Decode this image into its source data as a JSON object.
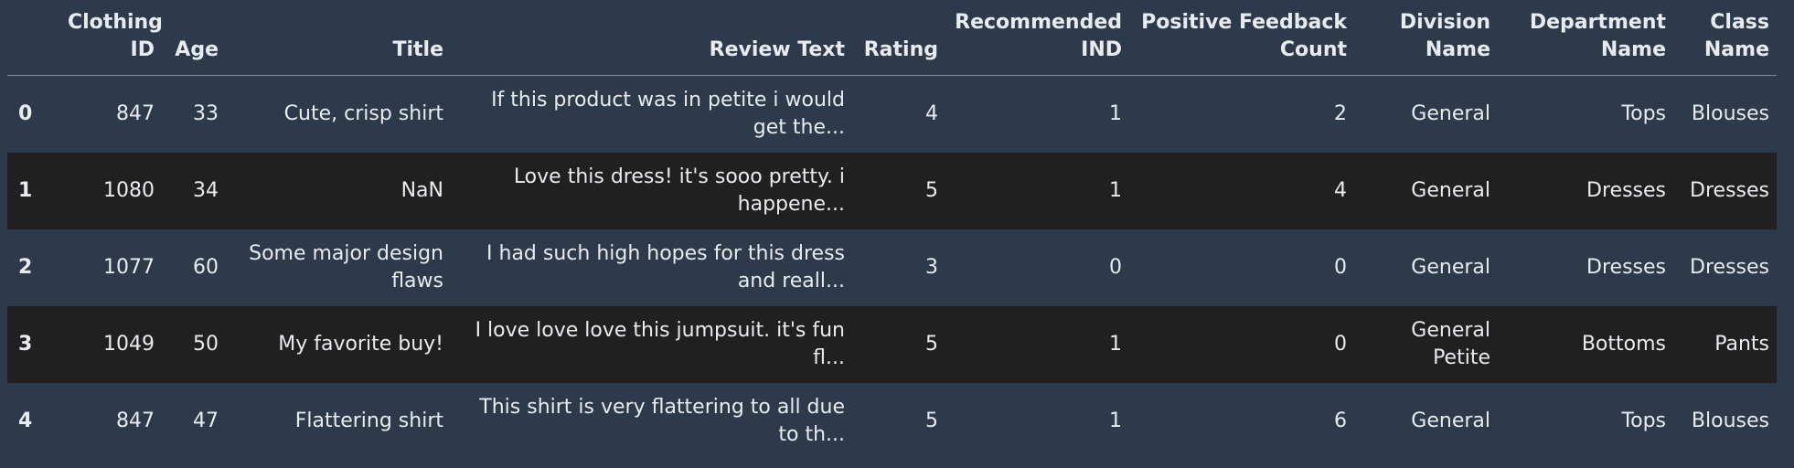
{
  "table": {
    "columns": [
      "",
      "Clothing ID",
      "Age",
      "Title",
      "Review Text",
      "Rating",
      "Recommended IND",
      "Positive Feedback Count",
      "Division Name",
      "Department Name",
      "Class Name"
    ],
    "rows": [
      {
        "index": "0",
        "clothing_id": "847",
        "age": "33",
        "title": "Cute, crisp shirt",
        "review_text": "If this product was in petite i would get the...",
        "rating": "4",
        "recommended_ind": "1",
        "positive_feedback_count": "2",
        "division_name": "General",
        "department_name": "Tops",
        "class_name": "Blouses"
      },
      {
        "index": "1",
        "clothing_id": "1080",
        "age": "34",
        "title": "NaN",
        "review_text": "Love this dress! it's sooo pretty. i happene...",
        "rating": "5",
        "recommended_ind": "1",
        "positive_feedback_count": "4",
        "division_name": "General",
        "department_name": "Dresses",
        "class_name": "Dresses"
      },
      {
        "index": "2",
        "clothing_id": "1077",
        "age": "60",
        "title": "Some major design flaws",
        "review_text": "I had such high hopes for this dress and reall...",
        "rating": "3",
        "recommended_ind": "0",
        "positive_feedback_count": "0",
        "division_name": "General",
        "department_name": "Dresses",
        "class_name": "Dresses"
      },
      {
        "index": "3",
        "clothing_id": "1049",
        "age": "50",
        "title": "My favorite buy!",
        "review_text": "I love love love this jumpsuit. it's fun fl...",
        "rating": "5",
        "recommended_ind": "1",
        "positive_feedback_count": "0",
        "division_name": "General Petite",
        "department_name": "Bottoms",
        "class_name": "Pants"
      },
      {
        "index": "4",
        "clothing_id": "847",
        "age": "47",
        "title": "Flattering shirt",
        "review_text": "This shirt is very flattering to all due to th...",
        "rating": "5",
        "recommended_ind": "1",
        "positive_feedback_count": "6",
        "division_name": "General",
        "department_name": "Tops",
        "class_name": "Blouses"
      }
    ]
  },
  "colors": {
    "background": "#2d3a4b",
    "alt_row": "#202020",
    "text": "#e8ebef",
    "header_rule": "#7f8a97"
  }
}
